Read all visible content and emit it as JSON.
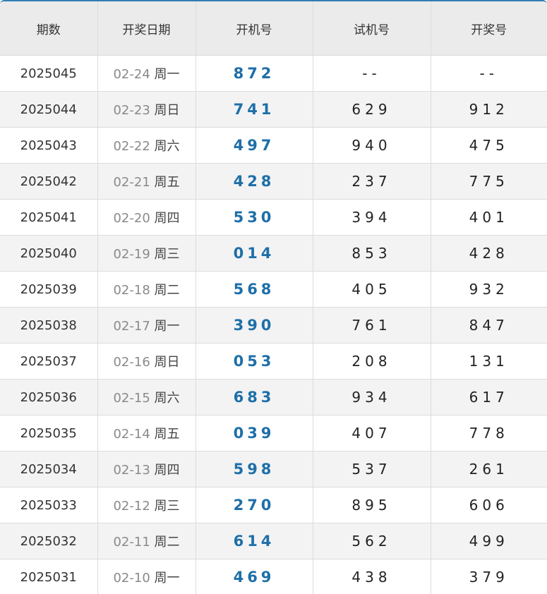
{
  "headers": [
    "期数",
    "开奖日期",
    "开机号",
    "试机号",
    "开奖号"
  ],
  "rows": [
    {
      "issue": "2025045",
      "date": "02-24",
      "week": "周一",
      "draw": "872",
      "trial": "--",
      "prize": "--"
    },
    {
      "issue": "2025044",
      "date": "02-23",
      "week": "周日",
      "draw": "741",
      "trial": "629",
      "prize": "912"
    },
    {
      "issue": "2025043",
      "date": "02-22",
      "week": "周六",
      "draw": "497",
      "trial": "940",
      "prize": "475"
    },
    {
      "issue": "2025042",
      "date": "02-21",
      "week": "周五",
      "draw": "428",
      "trial": "237",
      "prize": "775"
    },
    {
      "issue": "2025041",
      "date": "02-20",
      "week": "周四",
      "draw": "530",
      "trial": "394",
      "prize": "401"
    },
    {
      "issue": "2025040",
      "date": "02-19",
      "week": "周三",
      "draw": "014",
      "trial": "853",
      "prize": "428"
    },
    {
      "issue": "2025039",
      "date": "02-18",
      "week": "周二",
      "draw": "568",
      "trial": "405",
      "prize": "932"
    },
    {
      "issue": "2025038",
      "date": "02-17",
      "week": "周一",
      "draw": "390",
      "trial": "761",
      "prize": "847"
    },
    {
      "issue": "2025037",
      "date": "02-16",
      "week": "周日",
      "draw": "053",
      "trial": "208",
      "prize": "131"
    },
    {
      "issue": "2025036",
      "date": "02-15",
      "week": "周六",
      "draw": "683",
      "trial": "934",
      "prize": "617"
    },
    {
      "issue": "2025035",
      "date": "02-14",
      "week": "周五",
      "draw": "039",
      "trial": "407",
      "prize": "778"
    },
    {
      "issue": "2025034",
      "date": "02-13",
      "week": "周四",
      "draw": "598",
      "trial": "537",
      "prize": "261"
    },
    {
      "issue": "2025033",
      "date": "02-12",
      "week": "周三",
      "draw": "270",
      "trial": "895",
      "prize": "606"
    },
    {
      "issue": "2025032",
      "date": "02-11",
      "week": "周二",
      "draw": "614",
      "trial": "562",
      "prize": "499"
    },
    {
      "issue": "2025031",
      "date": "02-10",
      "week": "周一",
      "draw": "469",
      "trial": "438",
      "prize": "379"
    }
  ],
  "colors": {
    "accent": "#2f7eb5",
    "draw_number": "#1e6fa8",
    "header_bg": "#ebebeb",
    "stripe_bg": "#f3f3f3"
  }
}
